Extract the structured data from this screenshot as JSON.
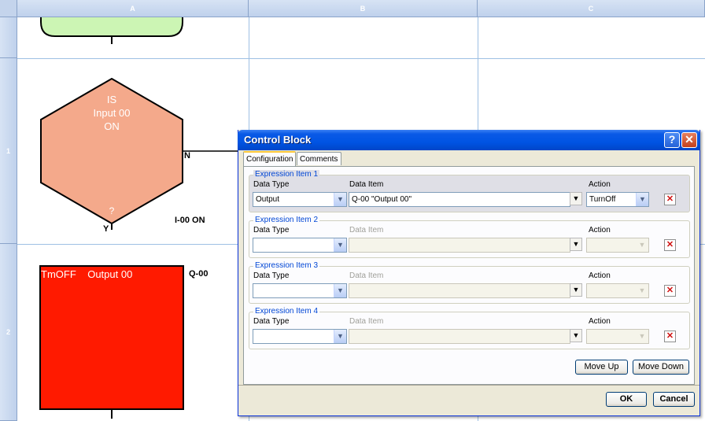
{
  "grid": {
    "columns": [
      "A",
      "B",
      "C"
    ],
    "rows": [
      "1",
      "2"
    ]
  },
  "flow": {
    "terminator_color": "#ccf5b4",
    "decision": {
      "lines": [
        "IS",
        "Input 00",
        "ON"
      ],
      "question": "?",
      "fill": "#f4a98b",
      "no_label": "N",
      "yes_label": "Y",
      "io_label": "I-00 ON"
    },
    "action": {
      "text": "TmOFF    Output 00",
      "fill": "#ff1a00",
      "io_label": "Q-00"
    }
  },
  "dialog": {
    "title": "Control Block",
    "help_glyph": "?",
    "close_glyph": "✕",
    "tabs": [
      "Configuration",
      "Comments"
    ],
    "labels": {
      "data_type": "Data Type",
      "data_item": "Data Item",
      "action": "Action"
    },
    "items": [
      {
        "title": "Expression Item 1",
        "data_type": "Output",
        "data_item": "Q-00 \"Output 00\"",
        "action": "TurnOff"
      },
      {
        "title": "Expression Item 2",
        "data_type": "",
        "data_item": "",
        "action": ""
      },
      {
        "title": "Expression Item 3",
        "data_type": "",
        "data_item": "",
        "action": ""
      },
      {
        "title": "Expression Item 4",
        "data_type": "",
        "data_item": "",
        "action": ""
      }
    ],
    "move_up": "Move Up",
    "move_down": "Move Down",
    "ok": "OK",
    "cancel": "Cancel"
  }
}
